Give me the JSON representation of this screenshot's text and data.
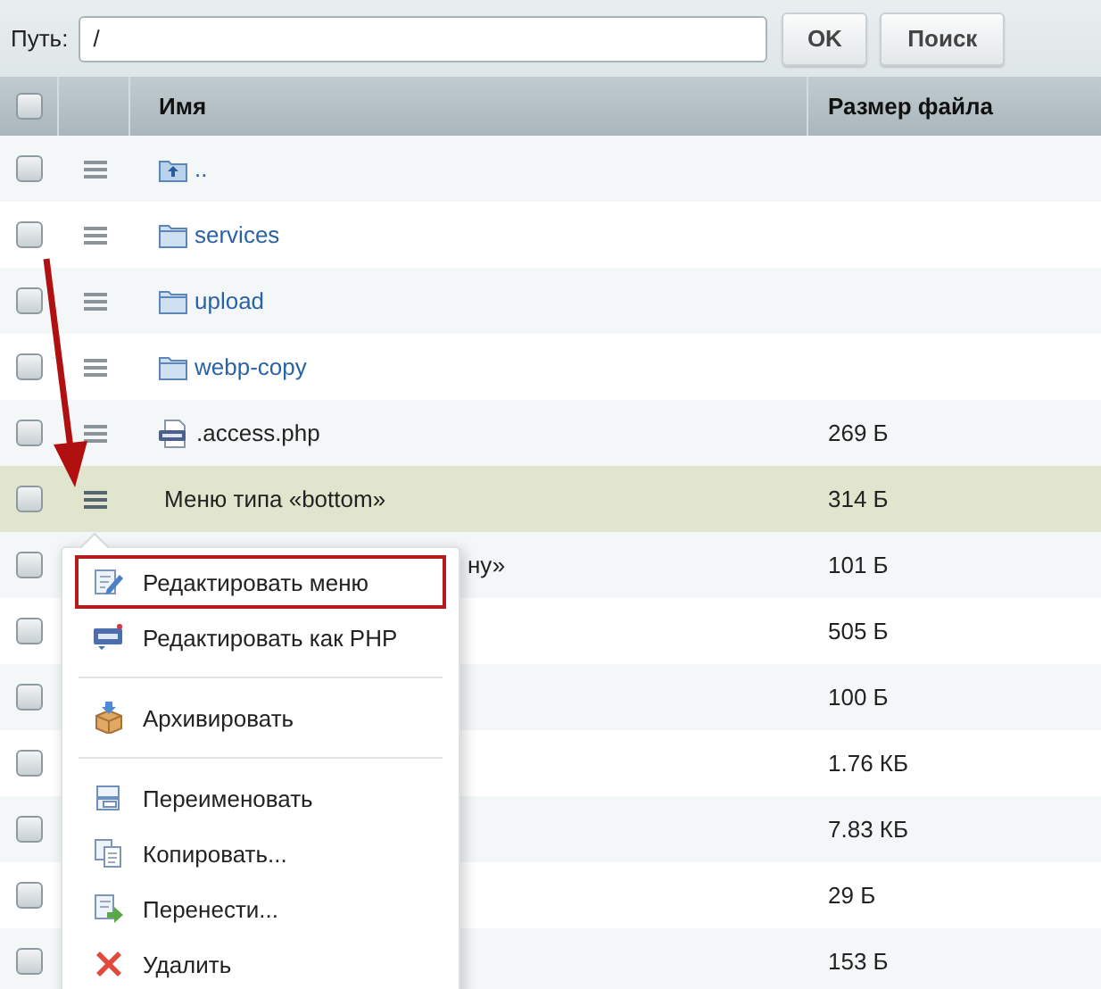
{
  "toolbar": {
    "path_label": "Путь:",
    "path_value": "/",
    "buttons": [
      "OK",
      "Поиск"
    ]
  },
  "table": {
    "header_checkbox": {
      "checked": false
    },
    "columns": [
      "Имя",
      "Размер файла"
    ],
    "rows": [
      {
        "kind": "parent",
        "name": "..",
        "size": "",
        "checked": false,
        "selected": false
      },
      {
        "kind": "folder",
        "name": "services",
        "size": "",
        "checked": false,
        "selected": false
      },
      {
        "kind": "folder",
        "name": "upload",
        "size": "",
        "checked": false,
        "selected": false
      },
      {
        "kind": "folder",
        "name": "webp-copy",
        "size": "",
        "checked": false,
        "selected": false
      },
      {
        "kind": "php",
        "name": ".access.php",
        "size": "269 Б",
        "checked": false,
        "selected": false
      },
      {
        "kind": "menu",
        "name": "Меню типа «bottom»",
        "size": "314 Б",
        "checked": false,
        "selected": true
      },
      {
        "kind": "covered",
        "name": "ну»",
        "size": "101 Б",
        "checked": false,
        "selected": false
      },
      {
        "kind": "covered",
        "name": "",
        "size": "505 Б",
        "checked": false,
        "selected": false
      },
      {
        "kind": "covered",
        "name": "",
        "size": "100 Б",
        "checked": false,
        "selected": false
      },
      {
        "kind": "covered",
        "name": "",
        "size": "1.76 КБ",
        "checked": false,
        "selected": false
      },
      {
        "kind": "covered",
        "name": "",
        "size": "7.83 КБ",
        "checked": false,
        "selected": false
      },
      {
        "kind": "covered",
        "name": "",
        "size": "29 Б",
        "checked": false,
        "selected": false
      },
      {
        "kind": "covered",
        "name": "",
        "size": "153 Б",
        "checked": false,
        "selected": false
      }
    ]
  },
  "context_menu": {
    "items": [
      {
        "kind": "item",
        "label": "Редактировать меню",
        "selected": true
      },
      {
        "kind": "item",
        "label": "Редактировать как PHP",
        "selected": false
      },
      {
        "kind": "separator"
      },
      {
        "kind": "item",
        "label": "Архивировать",
        "selected": false
      },
      {
        "kind": "separator"
      },
      {
        "kind": "item",
        "label": "Переименовать",
        "selected": false
      },
      {
        "kind": "item",
        "label": "Копировать...",
        "selected": false
      },
      {
        "kind": "item",
        "label": "Перенести...",
        "selected": false
      },
      {
        "kind": "item",
        "label": "Удалить",
        "selected": false
      }
    ]
  }
}
